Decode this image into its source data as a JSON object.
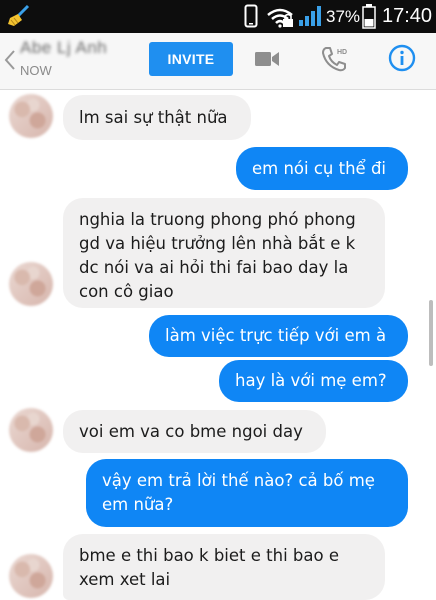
{
  "status_bar": {
    "battery_percent": "37%",
    "time": "17:40"
  },
  "header": {
    "contact_name": "Abe Lj Anh",
    "contact_status": "NOW",
    "invite_label": "INVITE"
  },
  "messages": [
    {
      "direction": "in",
      "text": "lm sai sự thật nữa"
    },
    {
      "direction": "out",
      "text": "em nói cụ thể đi"
    },
    {
      "direction": "in",
      "text": "nghia la truong phong phó phong gd va hiệu trưởng lên nhà bắt e k dc nói va ai hỏi thi fai bao day la con cô giao"
    },
    {
      "direction": "out",
      "text": "làm việc trực tiếp với em à"
    },
    {
      "direction": "out",
      "text": "hay là với mẹ em?"
    },
    {
      "direction": "in",
      "text": "voi em va co bme ngoi day"
    },
    {
      "direction": "out",
      "text": "vậy em trả lời thế nào? cả bố mẹ em nữa?"
    },
    {
      "direction": "in",
      "text": "bme e thi bao k biet e thi bao e xem xet lai"
    }
  ],
  "colors": {
    "accent": "#1f8ff0",
    "outgoing_bubble": "#0f86f5",
    "incoming_bubble": "#f1f0f0",
    "status_bar": "#0d0d0d"
  },
  "icons": [
    "broom-icon",
    "phone-outline-icon",
    "wifi-icon",
    "signal-icon",
    "battery-icon",
    "back-chevron-icon",
    "video-camera-icon",
    "hd-call-icon",
    "info-icon"
  ]
}
